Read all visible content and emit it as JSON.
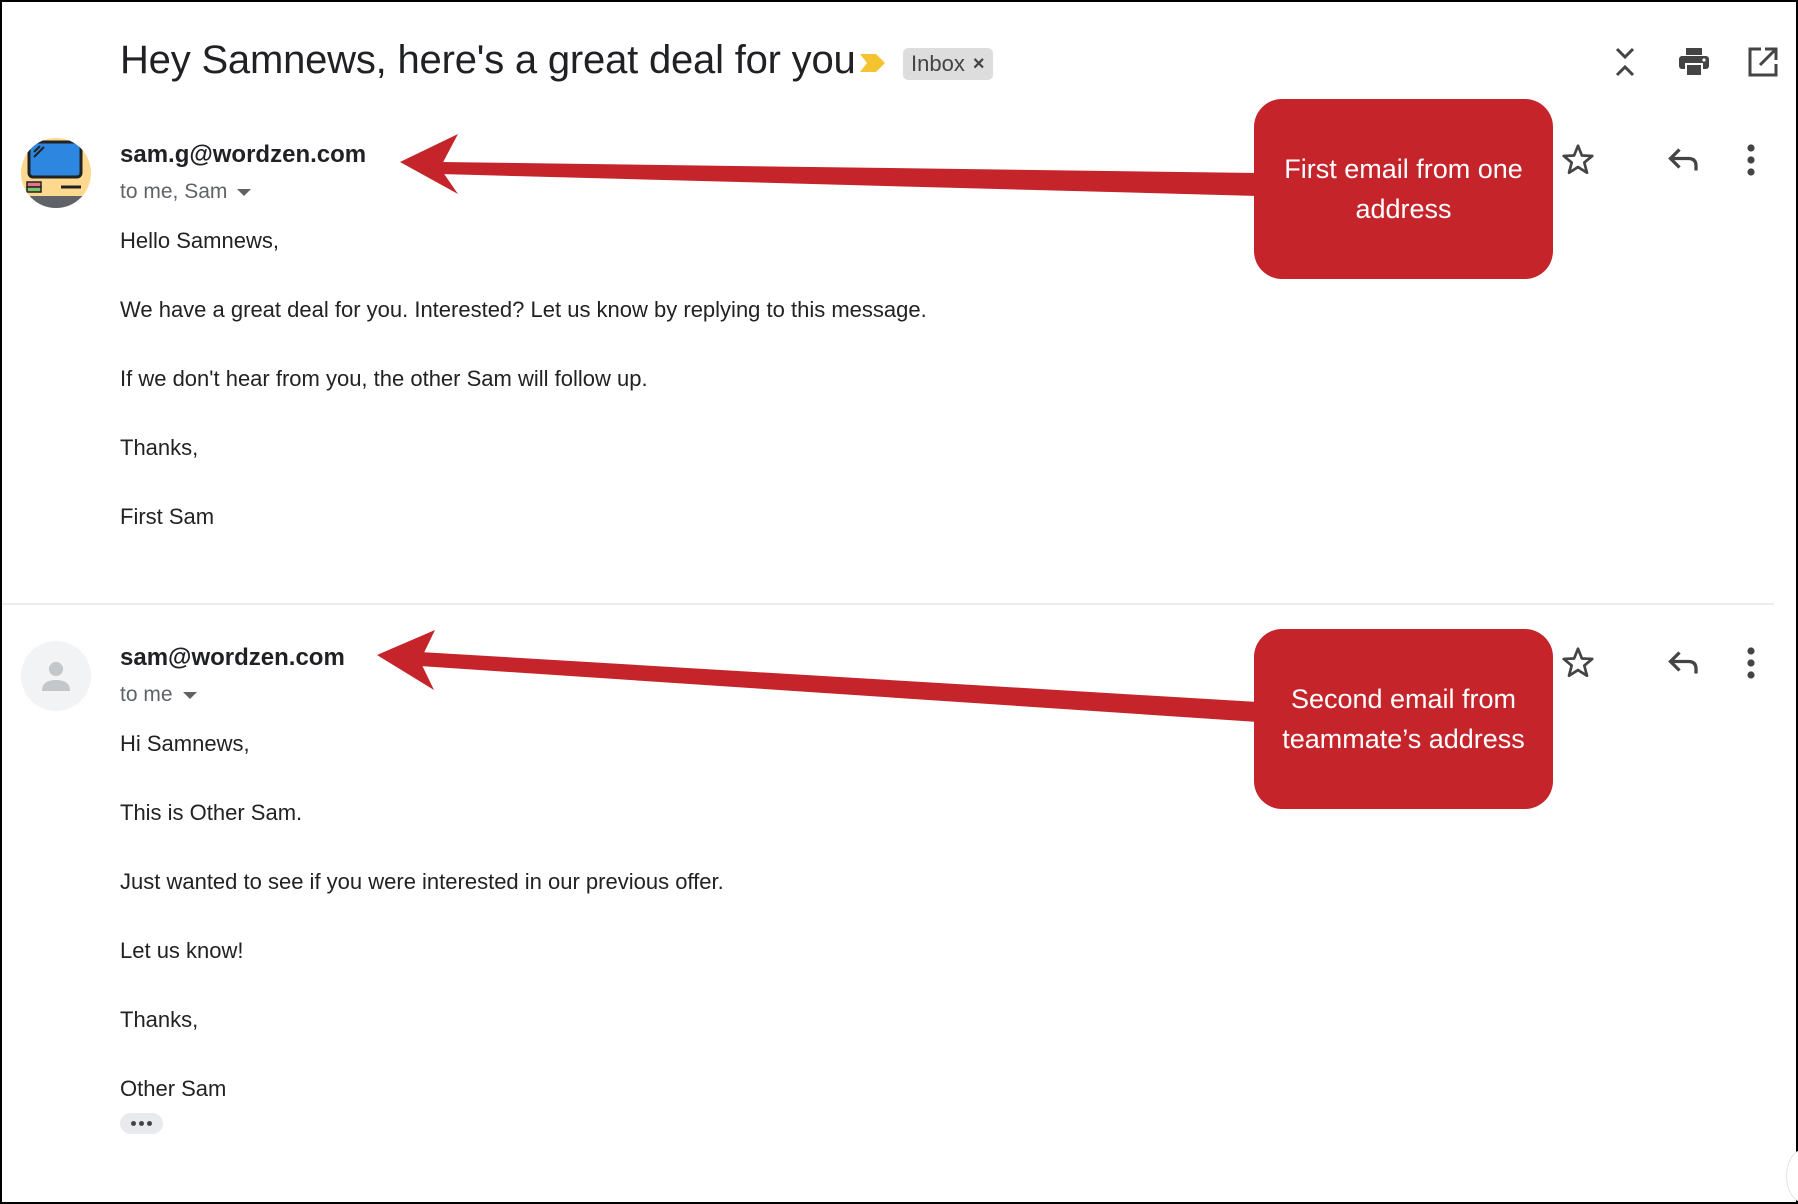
{
  "thread": {
    "subject": "Hey Samnews, here's a great deal for you",
    "importance_marker": "importance-marker-icon",
    "label_chip": {
      "text": "Inbox",
      "remove_symbol": "×"
    },
    "toolbar_icons": [
      "collapse-all-icon",
      "print-icon",
      "open-in-new-window-icon"
    ]
  },
  "messages": [
    {
      "sender": "sam.g@wordzen.com",
      "recipients": "to me, Sam",
      "avatar": "computer-avatar",
      "body": [
        "Hello Samnews,",
        "We have a great deal for you. Interested? Let us know by replying to this message.",
        "If we don't hear from you, the other Sam will follow up.",
        "Thanks,",
        "First Sam"
      ],
      "actions": [
        "star-icon",
        "reply-icon",
        "more-options-icon"
      ]
    },
    {
      "sender": "sam@wordzen.com",
      "recipients": "to me",
      "avatar": "default-person-avatar",
      "body": [
        "Hi Samnews,",
        "This is Other Sam.",
        "Just wanted to see if you were interested in our previous offer.",
        "Let us know!",
        "Thanks,",
        "Other Sam"
      ],
      "actions": [
        "star-icon",
        "reply-icon",
        "more-options-icon"
      ],
      "show_trimmed_content": "•••"
    }
  ],
  "annotations": [
    {
      "text": "First email from one address",
      "color": "#c4242a"
    },
    {
      "text": "Second email from teammate’s address",
      "color": "#c4242a"
    }
  ],
  "colors": {
    "callout": "#c4242a",
    "importance": "#f4c430",
    "chip_bg": "#dddddd"
  }
}
